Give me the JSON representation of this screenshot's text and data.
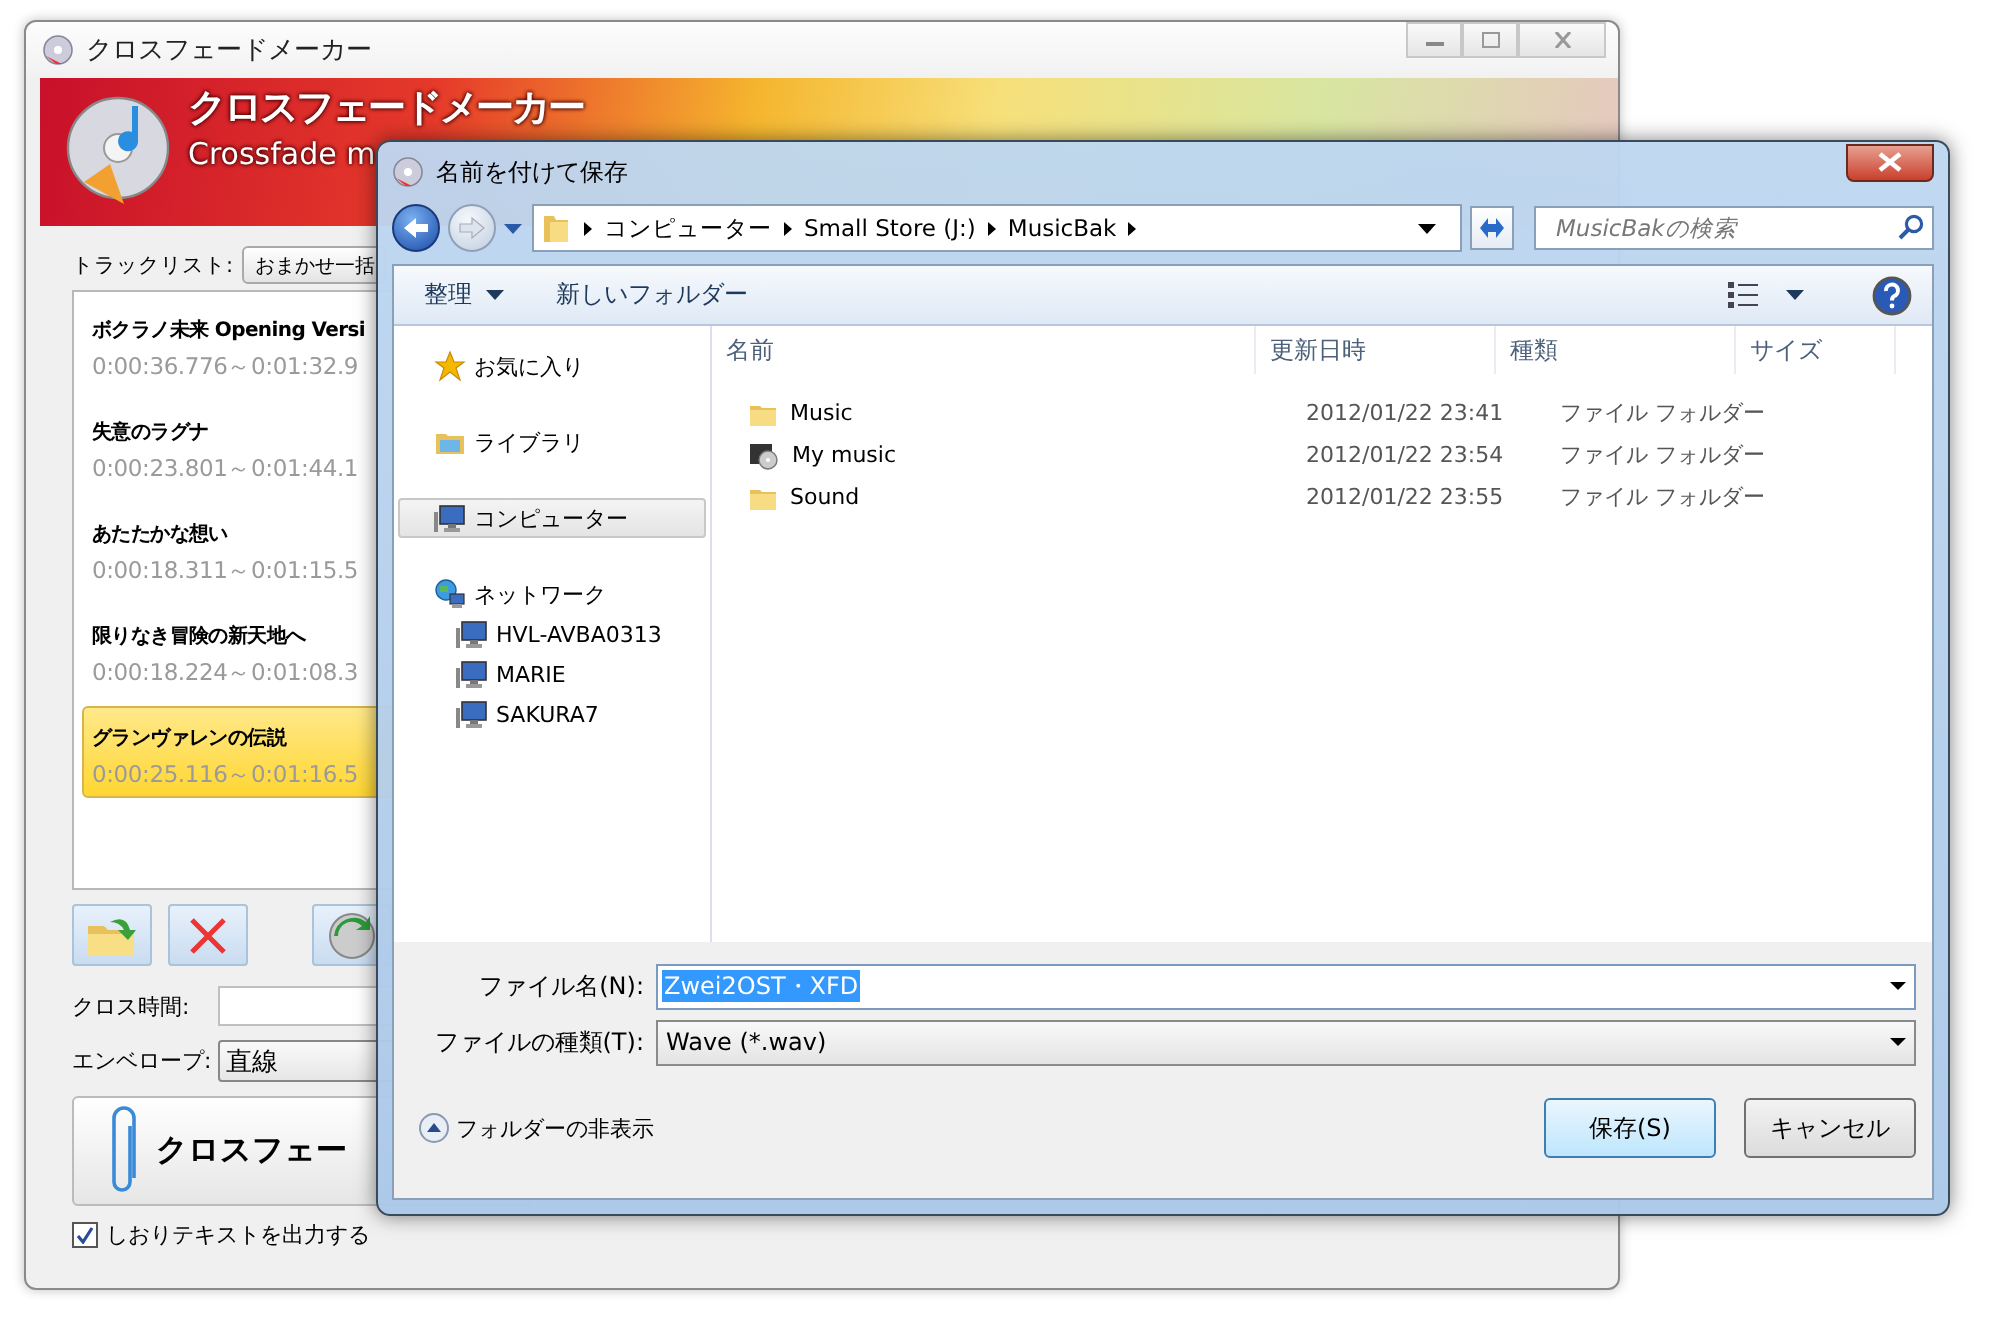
{
  "main_window": {
    "title": "クロスフェードメーカー",
    "banner": {
      "title": "クロスフェードメーカー",
      "subtitle": "Crossfade m"
    },
    "track_list_label": "トラックリスト:",
    "auto_button": "おまかせ一括",
    "tracks": [
      {
        "name": "ボクラノ未来 Opening Versi",
        "range": "0:00:36.776～0:01:32.9",
        "selected": false
      },
      {
        "name": "失意のラグナ",
        "range": "0:00:23.801～0:01:44.1",
        "selected": false
      },
      {
        "name": "あたたかな想い",
        "range": "0:00:18.311～0:01:15.5",
        "selected": false
      },
      {
        "name": "限りなき冒険の新天地へ",
        "range": "0:00:18.224～0:01:08.3",
        "selected": false
      },
      {
        "name": "グランヴァレンの伝説",
        "range": "0:00:25.116～0:01:16.5",
        "selected": true
      }
    ],
    "cross_time_label": "クロス時間:",
    "envelope_label": "エンベロープ:",
    "envelope_value": "直線",
    "crossfade_button": "クロスフェー",
    "bookmark_option": {
      "label": "しおりテキストを出力する",
      "checked": true
    }
  },
  "save_dialog": {
    "title": "名前を付けて保存",
    "breadcrumb": [
      "コンピューター",
      "Small Store (J:)",
      "MusicBak"
    ],
    "search": {
      "placeholder": "MusicBakの検索"
    },
    "toolbar": {
      "organize": "整理",
      "new_folder": "新しいフォルダー"
    },
    "nav": [
      {
        "label": "お気に入り",
        "kind": "favorites",
        "selected": false
      },
      {
        "label": "ライブラリ",
        "kind": "libraries",
        "selected": false
      },
      {
        "label": "コンピューター",
        "kind": "computer",
        "selected": true
      },
      {
        "label": "ネットワーク",
        "kind": "network",
        "selected": false,
        "children": [
          {
            "label": "HVL-AVBA0313",
            "kind": "pc",
            "selected": false
          },
          {
            "label": "MARIE",
            "kind": "pc",
            "selected": false
          },
          {
            "label": "SAKURA7",
            "kind": "pc",
            "selected": false
          }
        ]
      }
    ],
    "columns": [
      "名前",
      "更新日時",
      "種類",
      "サイズ"
    ],
    "files": [
      {
        "name": "Music",
        "modified": "2012/01/22 23:41",
        "type": "ファイル フォルダー",
        "kind": "folder"
      },
      {
        "name": "My music",
        "modified": "2012/01/22 23:54",
        "type": "ファイル フォルダー",
        "kind": "media-folder"
      },
      {
        "name": "Sound",
        "modified": "2012/01/22 23:55",
        "type": "ファイル フォルダー",
        "kind": "folder"
      }
    ],
    "file_name": {
      "label": "ファイル名(N):",
      "value": "Zwei2OST・XFD",
      "value_selected": true
    },
    "file_type": {
      "label": "ファイルの種類(T):",
      "value": "Wave (*.wav)"
    },
    "hide_folders": "フォルダーの非表示",
    "save_button": "保存(S)",
    "cancel_button": "キャンセル"
  }
}
